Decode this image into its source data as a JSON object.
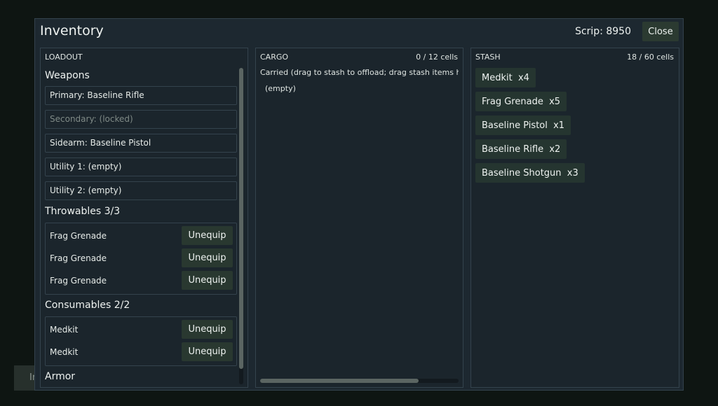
{
  "background": {
    "stub_text": "In"
  },
  "modal": {
    "title": "Inventory",
    "scrip": "Scrip: 8950",
    "close_label": "Close"
  },
  "loadout": {
    "header": "LOADOUT",
    "weapons_title": "Weapons",
    "slots": [
      {
        "label": "Primary: Baseline Rifle",
        "locked": false
      },
      {
        "label": "Secondary: (locked)",
        "locked": true
      },
      {
        "label": "Sidearm: Baseline Pistol",
        "locked": false
      },
      {
        "label": "Utility 1: (empty)",
        "locked": false
      },
      {
        "label": "Utility 2: (empty)",
        "locked": false
      }
    ],
    "throwables_title": "Throwables  3/3",
    "throwables": [
      {
        "name": "Frag Grenade",
        "action": "Unequip"
      },
      {
        "name": "Frag Grenade",
        "action": "Unequip"
      },
      {
        "name": "Frag Grenade",
        "action": "Unequip"
      }
    ],
    "consumables_title": "Consumables  2/2",
    "consumables": [
      {
        "name": "Medkit",
        "action": "Unequip"
      },
      {
        "name": "Medkit",
        "action": "Unequip"
      }
    ],
    "armor_title": "Armor"
  },
  "cargo": {
    "header": "CARGO",
    "cells": "0 / 12 cells",
    "carried_text": "Carried (drag to stash to offload; drag stash items h",
    "empty_text": "(empty)",
    "scroll_fraction": 0.8
  },
  "stash": {
    "header": "STASH",
    "cells": "18 / 60 cells",
    "items": [
      "Medkit  x4",
      "Frag Grenade  x5",
      "Baseline Pistol  x1",
      "Baseline Rifle  x2",
      "Baseline Shotgun  x3"
    ]
  },
  "colors": {
    "page_bg": "#0e1512",
    "modal_bg": "#1d2830",
    "panel_border": "#34434d",
    "button_bg": "#293830",
    "stash_chip_bg": "#253530",
    "locked_text": "#7f8a86"
  }
}
